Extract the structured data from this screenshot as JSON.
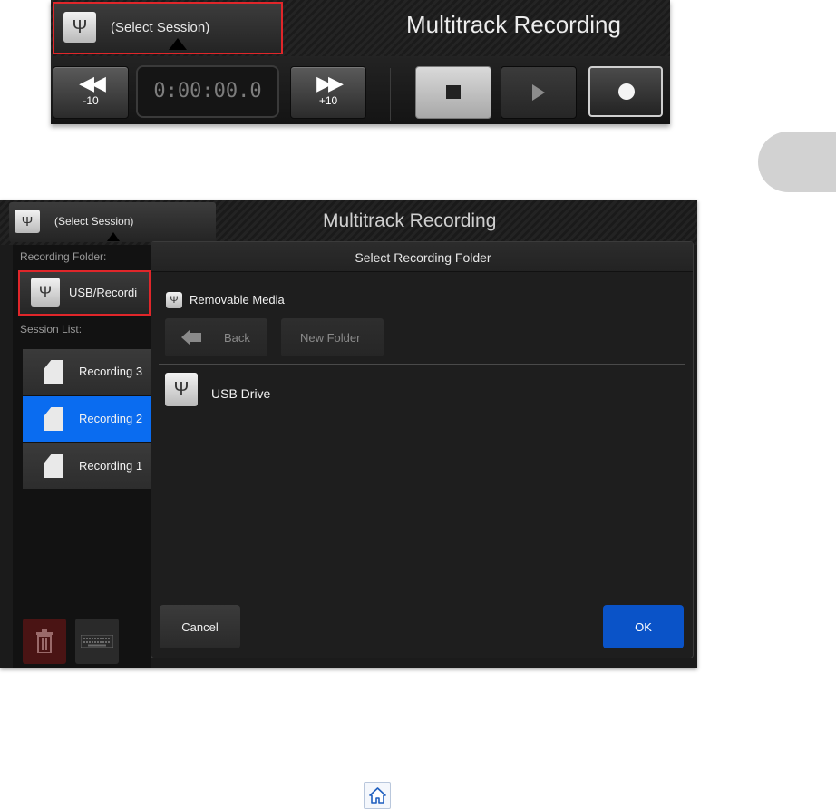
{
  "top_panel": {
    "session_button": {
      "label": "(Select Session)",
      "icon": "usb-icon"
    },
    "title": "Multitrack Recording",
    "transport": {
      "rewind": {
        "icon": "rewind-icon",
        "label": "-10"
      },
      "time": "0:00:00.0",
      "forward": {
        "icon": "fast-forward-icon",
        "label": "+10"
      },
      "stop": {
        "icon": "stop-icon"
      },
      "play": {
        "icon": "play-icon"
      },
      "record": {
        "icon": "record-icon"
      }
    }
  },
  "bottom_panel": {
    "session_button": {
      "label": "(Select Session)",
      "icon": "usb-icon"
    },
    "title": "Multitrack Recording",
    "recording_folder_label": "Recording Folder:",
    "folder_button_label": "USB/Recordi",
    "session_list_label": "Session List:",
    "sessions": [
      {
        "label": "Recording 3",
        "selected": false
      },
      {
        "label": "Recording 2",
        "selected": true
      },
      {
        "label": "Recording 1",
        "selected": false
      }
    ],
    "dialog": {
      "title": "Select Recording Folder",
      "path_label": "Removable Media",
      "back_label": "Back",
      "new_folder_label": "New Folder",
      "entries": [
        {
          "label": "USB Drive",
          "icon": "usb-drive-icon"
        }
      ],
      "cancel_label": "Cancel",
      "ok_label": "OK"
    }
  },
  "colors": {
    "highlight_border": "#e0262a",
    "selected_item": "#0a6cf0",
    "ok_button": "#0a53c8",
    "side_tab": "#d2d2d2"
  },
  "footer": {
    "icon": "home-icon"
  }
}
